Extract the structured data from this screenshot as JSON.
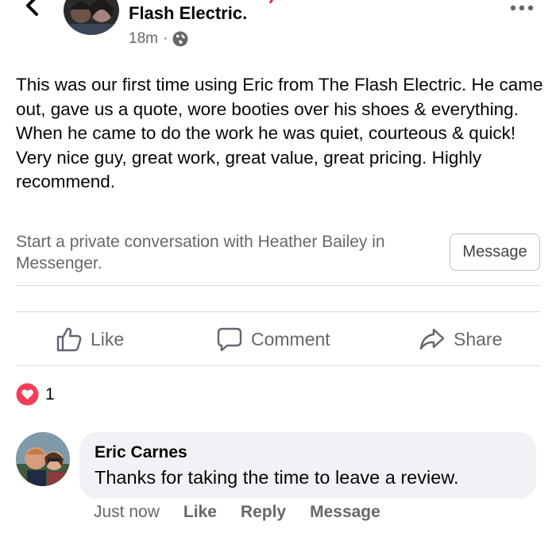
{
  "header": {
    "page_name": "Flash Electric.",
    "timestamp": "18m",
    "separator": "·",
    "privacy_icon": "globe-icon",
    "more_icon": "more-horizontal-icon",
    "back_icon": "chevron-left-icon"
  },
  "post": {
    "text": "This was our first time using Eric from The Flash Electric. He came out, gave us a quote, wore booties over his shoes & everything. When he came to do the work he was quiet, courteous & quick! Very nice guy, great work, great value, great pricing. Highly recommend."
  },
  "private_conversation": {
    "text": "Start a private conversation with Heather Bailey in Messenger.",
    "button_label": "Message"
  },
  "actions": {
    "like": "Like",
    "comment": "Comment",
    "share": "Share"
  },
  "reactions": {
    "icon": "love-reaction-icon",
    "count": "1"
  },
  "comment": {
    "author": "Eric Carnes",
    "text": "Thanks for taking the time to leave a review.",
    "time": "Just now",
    "like": "Like",
    "reply": "Reply",
    "message": "Message"
  },
  "colors": {
    "text": "#050505",
    "secondary": "#65676b",
    "bubble": "#f0f2f5",
    "love": "#f33e58"
  }
}
